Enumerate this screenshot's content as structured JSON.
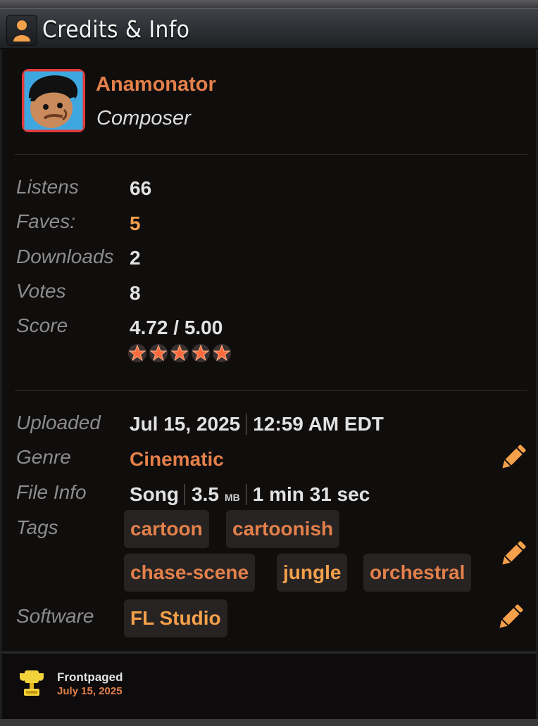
{
  "header": {
    "title": "Credits & Info",
    "icon": "user-icon"
  },
  "author": {
    "name": "Anamonator",
    "role": "Composer"
  },
  "stats": {
    "listens_label": "Listens",
    "listens": "66",
    "faves_label": "Faves:",
    "faves": "5",
    "downloads_label": "Downloads",
    "downloads": "2",
    "votes_label": "Votes",
    "votes": "8",
    "score_label": "Score",
    "score": "4.72 / 5.00",
    "stars": 5
  },
  "info": {
    "uploaded_label": "Uploaded",
    "uploaded_date": "Jul 15, 2025",
    "uploaded_time": "12:59 AM EDT",
    "genre_label": "Genre",
    "genre": "Cinematic",
    "fileinfo_label": "File Info",
    "file_type": "Song",
    "file_size": "3.5",
    "file_size_unit": "MB",
    "duration": "1 min 31 sec",
    "tags_label": "Tags",
    "tags": [
      "cartoon",
      "cartoonish",
      "chase-scene",
      "jungle",
      "orchestral"
    ],
    "software_label": "Software",
    "software": "FL Studio"
  },
  "footer": {
    "title": "Frontpaged",
    "date": "July 15, 2025"
  },
  "colors": {
    "accent": "#e3804a",
    "highlight": "#f5a04b",
    "panel": "#100d0d"
  }
}
